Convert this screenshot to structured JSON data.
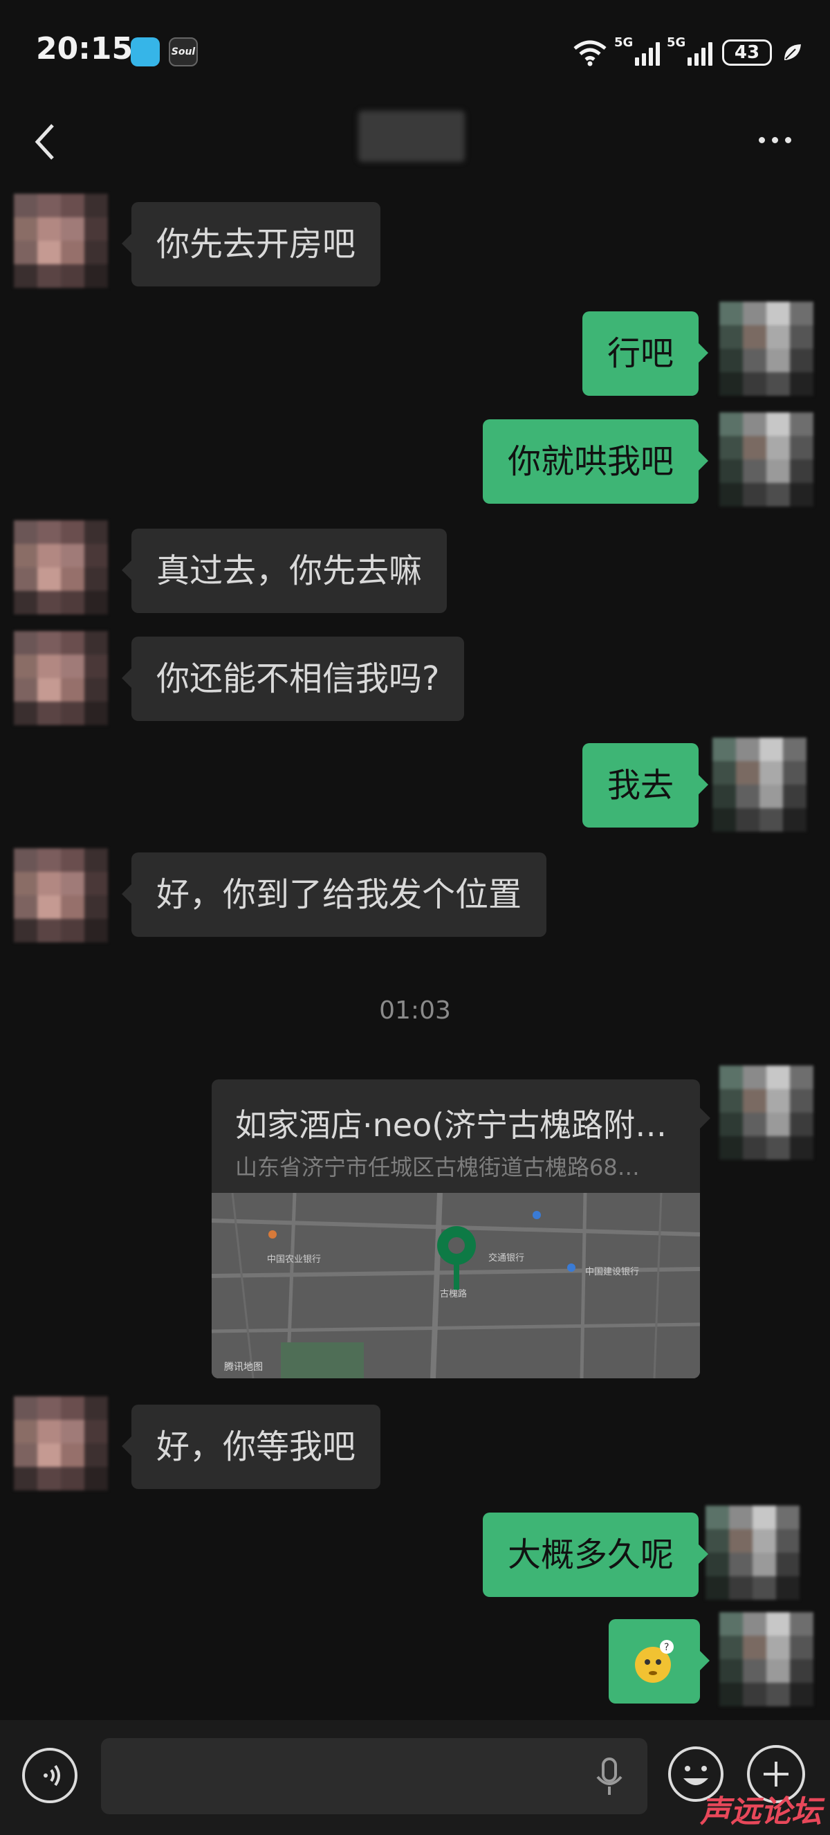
{
  "status_bar": {
    "time": "20:15",
    "app_icons": [
      "book-app-icon",
      "soul-app-icon"
    ],
    "soul_label": "Soul",
    "network_1": "5G",
    "network_2": "5G",
    "battery": "43"
  },
  "header": {
    "back_icon": "chevron-left-icon",
    "more_icon": "more-dots-icon"
  },
  "messages": [
    {
      "from": "friend",
      "text": "你先去开房吧"
    },
    {
      "from": "self",
      "text": "行吧"
    },
    {
      "from": "self",
      "text": "你就哄我吧"
    },
    {
      "from": "friend",
      "text": "真过去，你先去嘛"
    },
    {
      "from": "friend",
      "text": "你还能不相信我吗?"
    },
    {
      "from": "self",
      "text": "我去"
    },
    {
      "from": "friend",
      "text": "好，你到了给我发个位置"
    },
    {
      "from": "self",
      "type": "location"
    },
    {
      "from": "friend",
      "text": "好，你等我吧"
    },
    {
      "from": "self",
      "text": "大概多久呢"
    },
    {
      "from": "self",
      "type": "sticker",
      "icon": "confused-face-sticker"
    }
  ],
  "timestamp": "01:03",
  "location": {
    "title": "如家酒店·neo(济宁古槐路附…",
    "address": "山东省济宁市任城区古槐街道古槐路68…",
    "map_labels": {
      "bank": "中国农业银行",
      "traffic_bank": "交通银行",
      "ccb": "中国建设银行",
      "road": "古槐路",
      "provider": "腾讯地图"
    }
  },
  "input_bar": {
    "voice_icon": "voice-icon",
    "mic_icon": "microphone-icon",
    "emoji_icon": "emoji-icon",
    "plus_icon": "plus-icon"
  },
  "watermark": "声远论坛"
}
